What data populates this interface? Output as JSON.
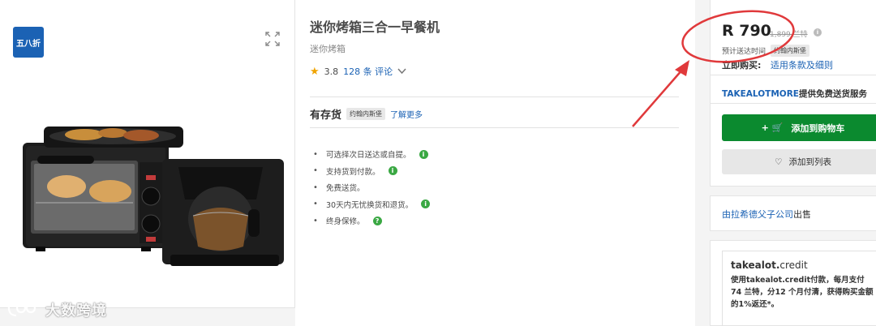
{
  "gallery": {
    "badge": "五八折",
    "watermark": "大数跨境"
  },
  "product": {
    "title": "迷你烤箱三合一早餐机",
    "subtitle": "迷你烤箱",
    "rating": "3.8",
    "reviews": "128 条 评论",
    "stock_label": "有存货",
    "location": "约翰内斯堡",
    "learn_more": "了解更多",
    "features": [
      {
        "text": "可选择次日送达或自提。",
        "icon": "i"
      },
      {
        "text": "支持货到付款。",
        "icon": "i"
      },
      {
        "text": "免费送货。",
        "icon": ""
      },
      {
        "text": "30天内无忧换货和退货。",
        "icon": "i"
      },
      {
        "text": "终身保修。",
        "icon": "?"
      }
    ]
  },
  "buybox": {
    "price": "R 790",
    "was_price": "1,899 兰特",
    "info_glyph": "i",
    "eta_label": "预计送达时间",
    "eta_location": "约翰内斯堡",
    "buy_now_label": "立即购买:",
    "terms": "适用条款及细则",
    "promo_code": "TAKEALOTMORE",
    "promo_text": "提供免费送货服务",
    "add_to_cart": "添加到购物车",
    "add_to_list": "添加到列表",
    "cart_icon": "+ 🛒",
    "heart_icon": "♡"
  },
  "seller": {
    "name": "由拉希德父子公司",
    "suffix": "出售"
  },
  "credit": {
    "logo_main": "takealot.",
    "logo_sub": "credit",
    "text": "使用takealot.credit付款，每月支付 74 兰特，分12 个月付清，获得购买金额的1%返还*。"
  },
  "colors": {
    "accent_blue": "#1b62b4",
    "cart_green": "#0b8a2f",
    "annotation_red": "#e0393b"
  }
}
